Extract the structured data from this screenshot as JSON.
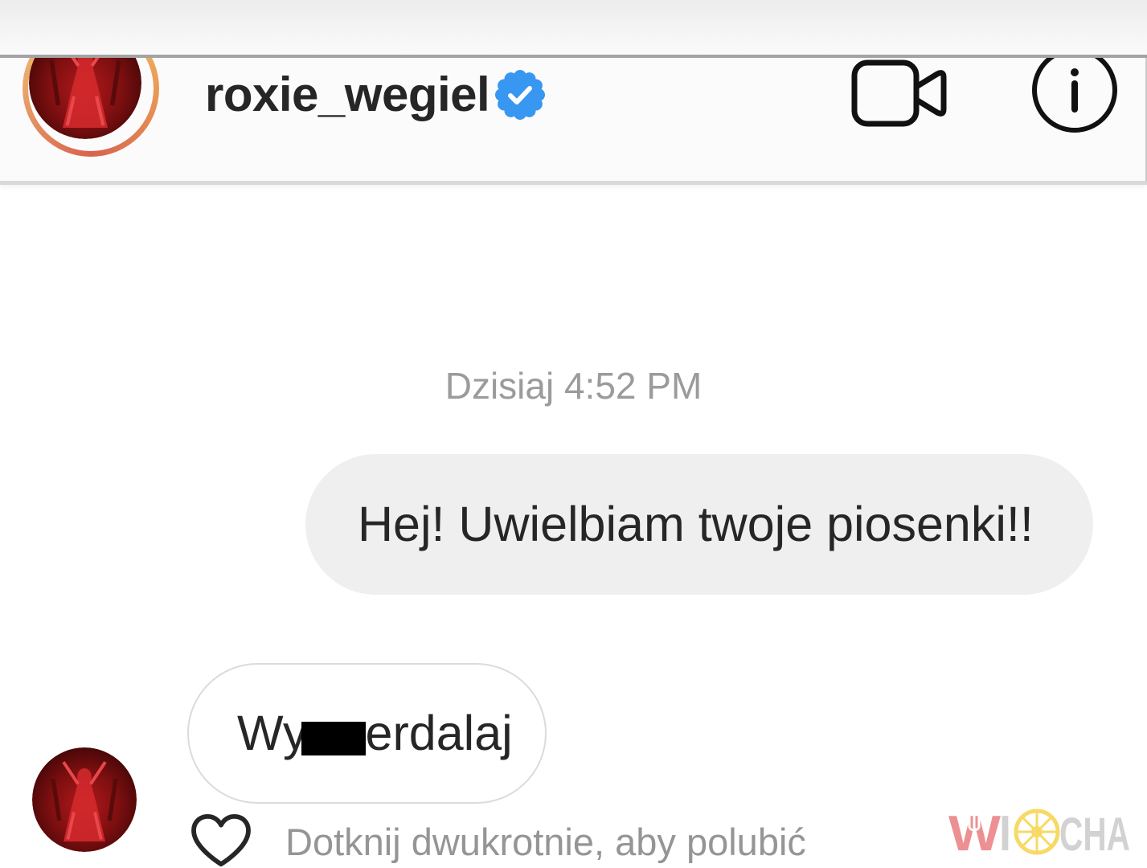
{
  "colors": {
    "text_primary": "#262626",
    "text_secondary": "#8e8e8e",
    "verified_blue": "#3897f0",
    "bubble_outgoing": "#efefef",
    "bubble_incoming_border": "#dbdbdb",
    "censor": "#000000",
    "watermark_red": "#e0474c",
    "watermark_yellow": "#f2c200",
    "watermark_gray": "#b5b5b5"
  },
  "header": {
    "username": "roxie_wegiel",
    "verified": true,
    "icons": {
      "avatar": "profile-avatar",
      "verified": "verified-badge-icon",
      "video_call": "video-camera-icon",
      "info": "info-icon"
    }
  },
  "thread": {
    "timestamp": "Dzisiaj 4:52 PM",
    "outgoing_message": {
      "text": "Hej! Uwielbiam twoje piosenki!!"
    },
    "incoming_message": {
      "text_before_censor": "Wy",
      "text_after_censor": "erdalaj",
      "censored": true
    },
    "like_hint": "Dotknij dwukrotnie, aby polubić",
    "icons": {
      "like": "heart-outline-icon",
      "sender_avatar": "profile-avatar"
    }
  },
  "watermark": {
    "letter_w": "W",
    "letter_i": "I",
    "letters_cha": "CHA",
    "wheel_icon": "wheel-icon"
  }
}
